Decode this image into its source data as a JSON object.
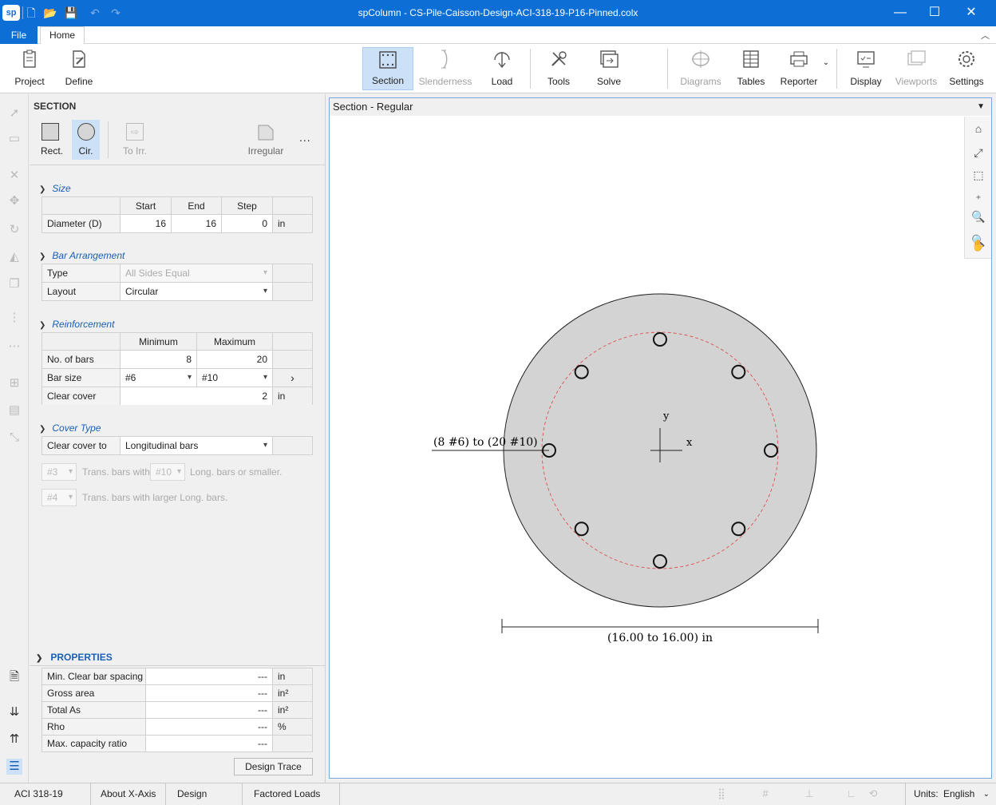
{
  "app": {
    "title": "spColumn - CS-Pile-Caisson-Design-ACI-318-19-P16-Pinned.colx",
    "logo": "sp"
  },
  "menu": {
    "file": "File",
    "home": "Home"
  },
  "ribbon": {
    "project": "Project",
    "define": "Define",
    "section": "Section",
    "slenderness": "Slenderness",
    "load": "Load",
    "tools": "Tools",
    "solve": "Solve",
    "diagrams": "Diagrams",
    "tables": "Tables",
    "reporter": "Reporter",
    "display": "Display",
    "viewports": "Viewports",
    "settings": "Settings"
  },
  "panel": {
    "header": "SECTION",
    "shapes": {
      "rect": "Rect.",
      "cir": "Cir.",
      "to_irr": "To Irr.",
      "irregular": "Irregular",
      "more": "..."
    },
    "size": {
      "title": "Size",
      "headers": [
        "Start",
        "End",
        "Step"
      ],
      "diameter_label": "Diameter (D)",
      "start": "16",
      "end": "16",
      "step": "0",
      "unit": "in"
    },
    "bar_arrangement": {
      "title": "Bar Arrangement",
      "type_label": "Type",
      "type_value": "All Sides Equal",
      "layout_label": "Layout",
      "layout_value": "Circular"
    },
    "reinforcement": {
      "title": "Reinforcement",
      "headers": [
        "Minimum",
        "Maximum"
      ],
      "bars_label": "No. of bars",
      "bars_min": "8",
      "bars_max": "20",
      "size_label": "Bar size",
      "size_min": "#6",
      "size_max": "#10",
      "cover_label": "Clear cover",
      "cover_value": "2",
      "cover_unit": "in"
    },
    "cover_type": {
      "title": "Cover Type",
      "label": "Clear cover to",
      "value": "Longitudinal bars",
      "trans1_bar": "#3",
      "trans1_text1": "Trans. bars with",
      "trans1_long": "#10",
      "trans1_text2": "Long. bars or smaller.",
      "trans2_bar": "#4",
      "trans2_text": "Trans. bars with larger Long. bars."
    },
    "properties": {
      "title": "PROPERTIES",
      "rows": [
        {
          "label": "Min. Clear bar spacing",
          "value": "---",
          "unit": "in"
        },
        {
          "label": "Gross area",
          "value": "---",
          "unit": "in²"
        },
        {
          "label": "Total As",
          "value": "---",
          "unit": "in²"
        },
        {
          "label": "Rho",
          "value": "---",
          "unit": "%"
        },
        {
          "label": "Max. capacity ratio",
          "value": "---",
          "unit": ""
        }
      ],
      "design_trace": "Design Trace"
    }
  },
  "view": {
    "title": "Section - Regular",
    "bar_label": "(8 #6) to (20 #10)",
    "dim_label": "(16.00 to 16.00) in",
    "axis_x": "x",
    "axis_y": "y",
    "bars_shown": 8
  },
  "status": {
    "code": "ACI 318-19",
    "axis": "About X-Axis",
    "mode": "Design",
    "loads": "Factored Loads",
    "units_label": "Units:",
    "units_value": "English"
  },
  "colors": {
    "accent": "#0d6fd6",
    "section_fill": "#d3d3d3",
    "cover_line": "#e04040"
  }
}
